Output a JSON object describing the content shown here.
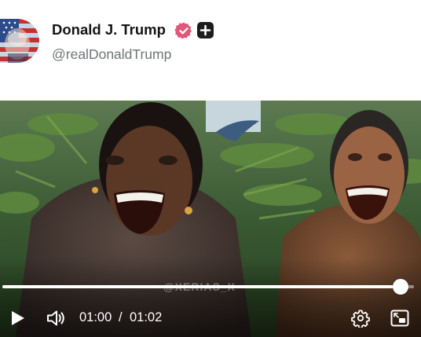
{
  "post": {
    "display_name": "Donald J. Trump",
    "handle": "@realDonaldTrump",
    "avatar_icon": "flag-portrait-avatar",
    "verified_icon": "verified-badge-icon",
    "badge_icon": "plus-badge-icon"
  },
  "video": {
    "watermark": "@XERIAS_X",
    "current_time": "01:00",
    "separator": "/",
    "duration": "01:02",
    "progress_fraction": 0.967,
    "controls": {
      "play_icon": "play-icon",
      "volume_icon": "volume-icon",
      "settings_icon": "gear-icon",
      "pip_icon": "picture-in-picture-icon"
    }
  },
  "colors": {
    "name_text": "#141414",
    "handle_text": "#6f7478",
    "verified_badge": "#e0577a",
    "controls": "#ffffff"
  }
}
